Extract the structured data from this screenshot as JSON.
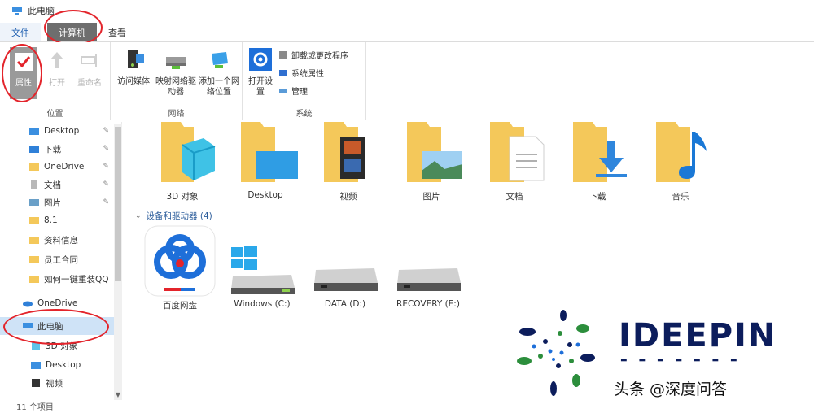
{
  "window": {
    "title": "此电脑"
  },
  "tabs": [
    {
      "label": "文件"
    },
    {
      "label": "计算机"
    },
    {
      "label": "查看"
    }
  ],
  "ribbon": {
    "location_group": {
      "label": "位置",
      "buttons": [
        {
          "label": "属性"
        },
        {
          "label": "打开"
        },
        {
          "label": "重命名"
        }
      ]
    },
    "network_group": {
      "label": "网络",
      "buttons": [
        {
          "label": "访问媒体"
        },
        {
          "label": "映射网络驱动器"
        },
        {
          "label": "添加一个网络位置"
        }
      ]
    },
    "system_group": {
      "label": "系统",
      "open_settings": "打开设置",
      "items": [
        {
          "label": "卸载或更改程序"
        },
        {
          "label": "系统属性"
        },
        {
          "label": "管理"
        }
      ]
    }
  },
  "nav": {
    "items": [
      {
        "label": "Desktop",
        "pinned": true
      },
      {
        "label": "下载",
        "pinned": true
      },
      {
        "label": "OneDrive",
        "pinned": true
      },
      {
        "label": "文档",
        "pinned": true
      },
      {
        "label": "图片",
        "pinned": true
      },
      {
        "label": "8.1"
      },
      {
        "label": "资料信息"
      },
      {
        "label": "员工合同"
      },
      {
        "label": "如何一键重装QQ"
      },
      {
        "label": "OneDrive"
      },
      {
        "label": "此电脑"
      },
      {
        "label": "3D 对象"
      },
      {
        "label": "Desktop"
      },
      {
        "label": "视频"
      }
    ]
  },
  "status": {
    "text": "11 个项目"
  },
  "main": {
    "folders": [
      {
        "label": "3D 对象"
      },
      {
        "label": "Desktop"
      },
      {
        "label": "视频"
      },
      {
        "label": "图片"
      },
      {
        "label": "文档"
      },
      {
        "label": "下载"
      },
      {
        "label": "音乐"
      }
    ],
    "devices_header": "设备和驱动器 (4)",
    "drives": [
      {
        "label": "百度网盘"
      },
      {
        "label": "Windows (C:)"
      },
      {
        "label": "DATA (D:)"
      },
      {
        "label": "RECOVERY (E:)"
      }
    ]
  },
  "watermark": {
    "brand": "IDEEPIN",
    "caption": "头条 @深度问答"
  },
  "colors": {
    "accent_blue": "#1e6fd9",
    "folder_yellow": "#f4c85a",
    "annotation_red": "#e3242b",
    "selected_bg": "#cfe3f7"
  }
}
